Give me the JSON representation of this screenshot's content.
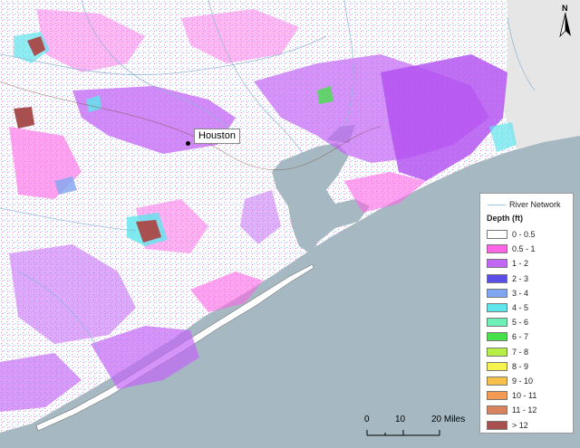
{
  "city": {
    "name": "Houston"
  },
  "north_arrow": {
    "label": "N"
  },
  "legend": {
    "river_label": "River Network",
    "title": "Depth (ft)",
    "classes": [
      {
        "label": "0 - 0.5",
        "color": "#ffffff"
      },
      {
        "label": "0.5 - 1",
        "color": "#ff66e6"
      },
      {
        "label": "1 - 2",
        "color": "#c266f5"
      },
      {
        "label": "2 - 3",
        "color": "#5b4ee8"
      },
      {
        "label": "3 - 4",
        "color": "#7fa6f0"
      },
      {
        "label": "4 - 5",
        "color": "#5fe6ec"
      },
      {
        "label": "5 - 6",
        "color": "#6ef0b6"
      },
      {
        "label": "6 - 7",
        "color": "#46e04a"
      },
      {
        "label": "7 - 8",
        "color": "#b6f046"
      },
      {
        "label": "8 - 9",
        "color": "#f6f24e"
      },
      {
        "label": "9 - 10",
        "color": "#f6c04a"
      },
      {
        "label": "10 - 11",
        "color": "#f49a52"
      },
      {
        "label": "11 - 12",
        "color": "#d9835e"
      },
      {
        "label": "> 12",
        "color": "#a85050"
      }
    ]
  },
  "scale_bar": {
    "labels": [
      "0",
      "10",
      "20 Miles"
    ]
  },
  "colors": {
    "water": "#a6b8c2",
    "land_east": "#e6e6e6",
    "land": "#ffffff"
  }
}
